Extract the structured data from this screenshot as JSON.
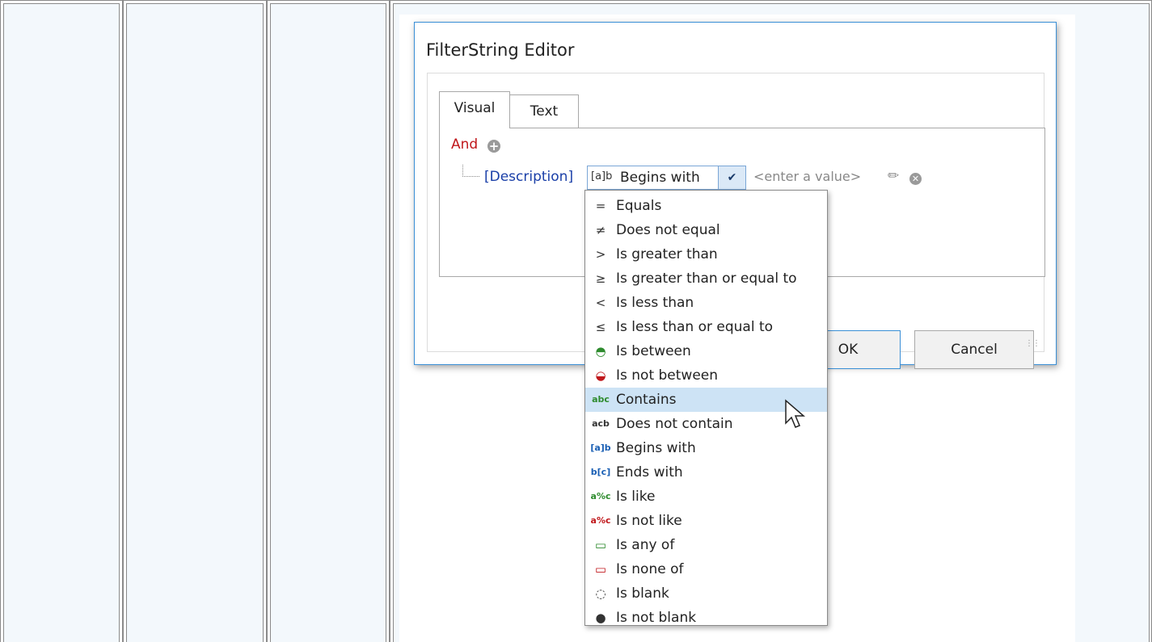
{
  "dialog": {
    "title": "FilterString Editor",
    "tabs": [
      "Visual",
      "Text"
    ],
    "group_operator": "And",
    "condition": {
      "field": "[Description]",
      "operator": "Begins with",
      "operator_icon": "[a]b",
      "value_placeholder": "<enter a value>"
    },
    "buttons": {
      "ok": "OK",
      "cancel": "Cancel"
    }
  },
  "operators": [
    {
      "icon": "=",
      "label": "Equals"
    },
    {
      "icon": "≠",
      "label": "Does not equal"
    },
    {
      "icon": ">",
      "label": "Is greater than"
    },
    {
      "icon": "≥",
      "label": "Is greater than or equal to"
    },
    {
      "icon": "<",
      "label": "Is less than"
    },
    {
      "icon": "≤",
      "label": "Is less than or equal to"
    },
    {
      "icon": "◓",
      "label": "Is between"
    },
    {
      "icon": "◒",
      "label": "Is not between"
    },
    {
      "icon": "abc",
      "label": "Contains"
    },
    {
      "icon": "acb",
      "label": "Does not contain"
    },
    {
      "icon": "[a]b",
      "label": "Begins with"
    },
    {
      "icon": "b[c]",
      "label": "Ends with"
    },
    {
      "icon": "a%c",
      "label": "Is like"
    },
    {
      "icon": "a%c",
      "label": "Is not like"
    },
    {
      "icon": "▭",
      "label": "Is any of"
    },
    {
      "icon": "▭",
      "label": "Is none of"
    },
    {
      "icon": "◌",
      "label": "Is blank"
    },
    {
      "icon": "●",
      "label": "Is not blank"
    }
  ],
  "highlighted_operator": "Contains",
  "colors": {
    "accent": "#3a8fd6",
    "and_red": "#c0181c",
    "field_blue": "#1a3fa8",
    "highlight": "#cde3f5"
  }
}
